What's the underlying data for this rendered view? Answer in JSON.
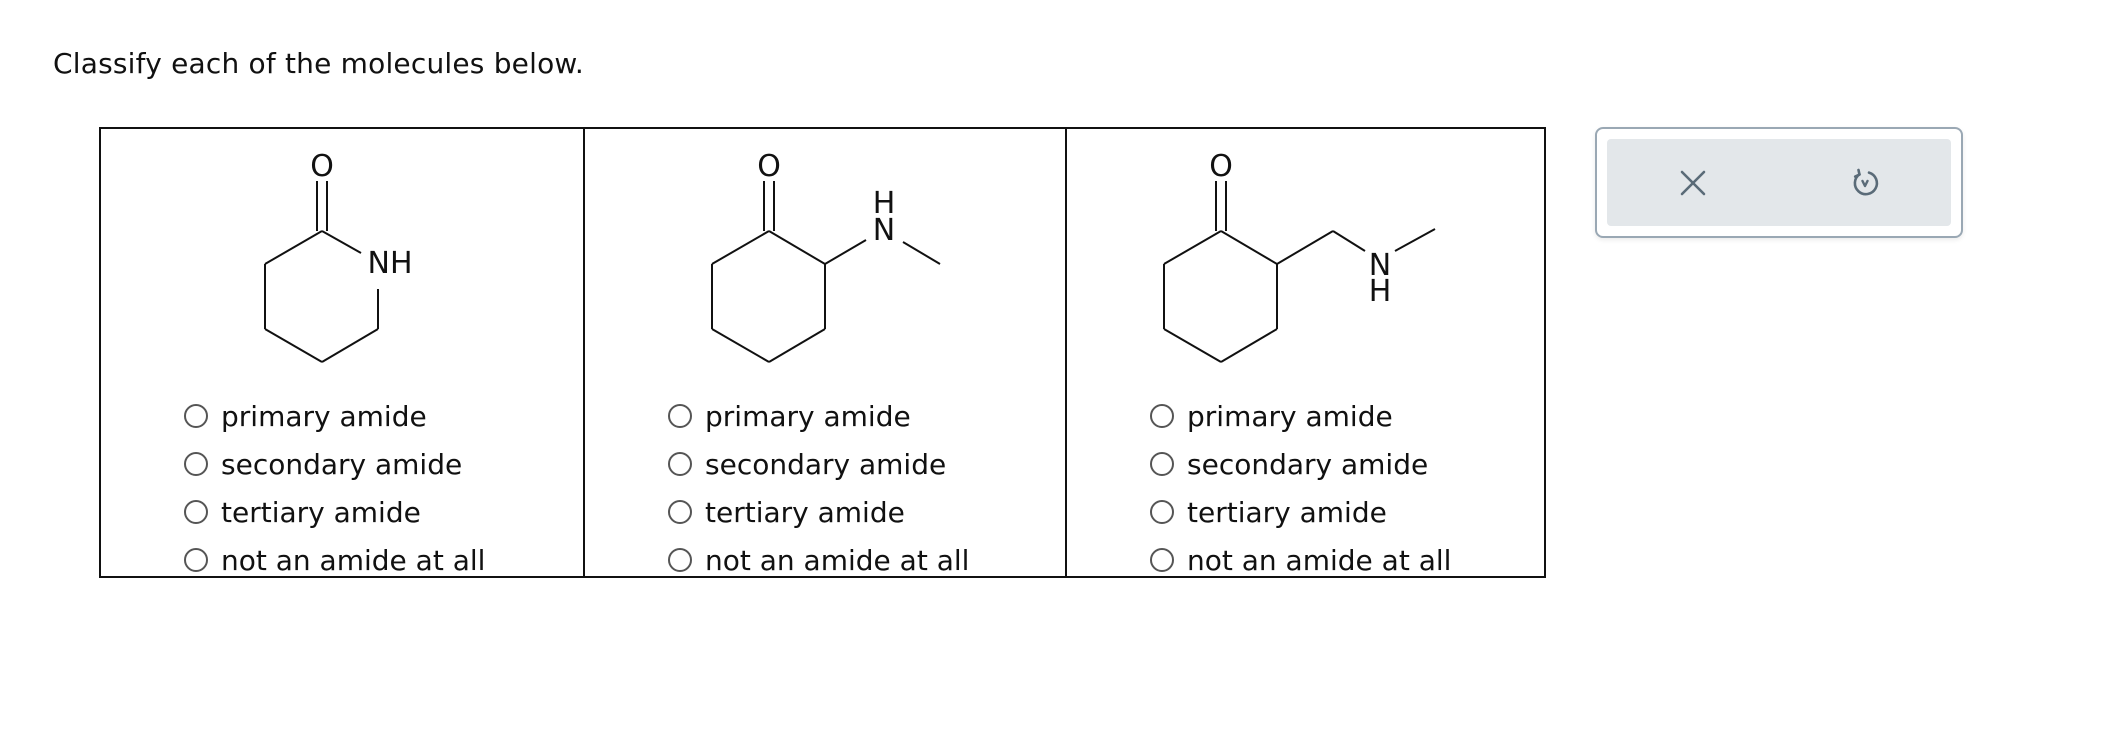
{
  "prompt": "Classify each of the molecules below.",
  "molecules": [
    {
      "atoms": {
        "oxygen": "O",
        "nitrogen": "NH"
      },
      "options": [
        "primary amide",
        "secondary amide",
        "tertiary amide",
        "not an amide at all"
      ],
      "selected": null
    },
    {
      "atoms": {
        "oxygen": "O",
        "nitrogen_h": "H",
        "nitrogen": "N"
      },
      "options": [
        "primary amide",
        "secondary amide",
        "tertiary amide",
        "not an amide at all"
      ],
      "selected": null
    },
    {
      "atoms": {
        "oxygen": "O",
        "nitrogen": "N",
        "nitrogen_h": "H"
      },
      "options": [
        "primary amide",
        "secondary amide",
        "tertiary amide",
        "not an amide at all"
      ],
      "selected": null
    }
  ],
  "toolbar": {
    "clear_icon": "close-icon",
    "reset_icon": "undo-icon",
    "icon_color": "#5a6b78"
  }
}
